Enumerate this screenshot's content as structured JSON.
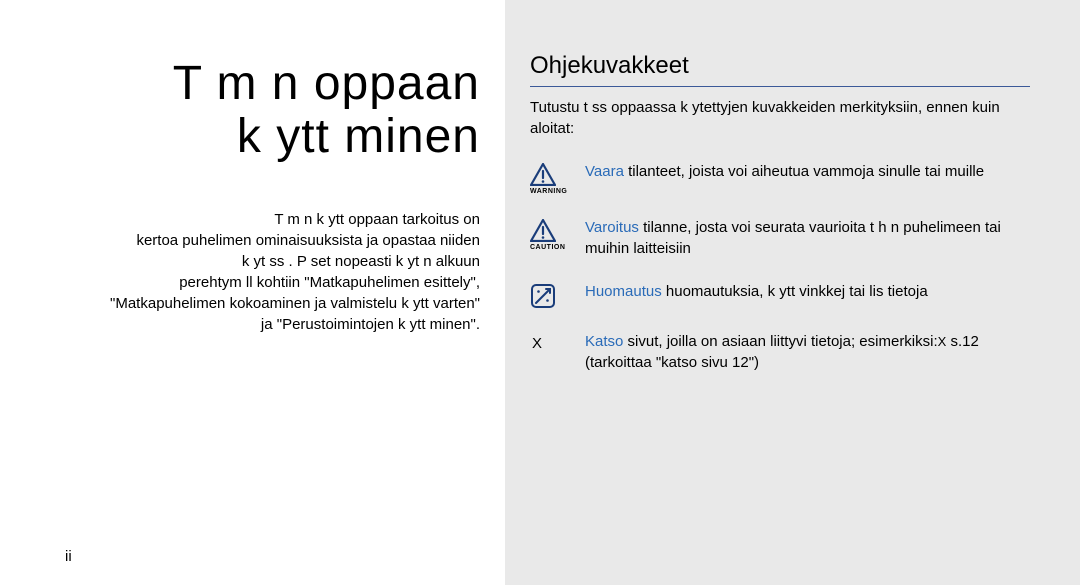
{
  "left": {
    "title_line1": "T m n oppaan",
    "title_line2": "k ytt minen",
    "intro": "T m n k ytt oppaan tarkoitus on\nkertoa puhelimen ominaisuuksista ja opastaa niiden\nk yt ss . P set nopeasti k yt n alkuun\nperehtym ll  kohtiin \"Matkapuhelimen esittely\",\n\"Matkapuhelimen kokoaminen ja valmistelu k ytt   varten\"\nja \"Perustoimintojen k ytt minen\".",
    "page_num": "ii"
  },
  "right": {
    "section_title": "Ohjekuvakkeet",
    "section_intro": "Tutustu t ss  oppaassa k ytettyjen kuvakkeiden merkityksiin, ennen kuin aloitat:",
    "rows": [
      {
        "label": "WARNING",
        "keyword": "Vaara",
        "text": "  tilanteet, joista voi aiheutua vammoja sinulle tai muille"
      },
      {
        "label": "CAUTION",
        "keyword": "Varoitus",
        "text": "  tilanne, josta voi seurata vaurioita t h n puhelimeen tai muihin laitteisiin"
      },
      {
        "keyword": "Huomautus",
        "text": "  huomautuksia, k ytt vinkkej  tai lis tietoja"
      },
      {
        "symbol": "X",
        "keyword": "Katso",
        "text_pre": "  sivut, joilla on asiaan liittyvi  tietoja; esimerkiksi:",
        "ref": "X",
        "text_post": " s.12 (tarkoittaa \"katso sivu 12\")"
      }
    ]
  }
}
